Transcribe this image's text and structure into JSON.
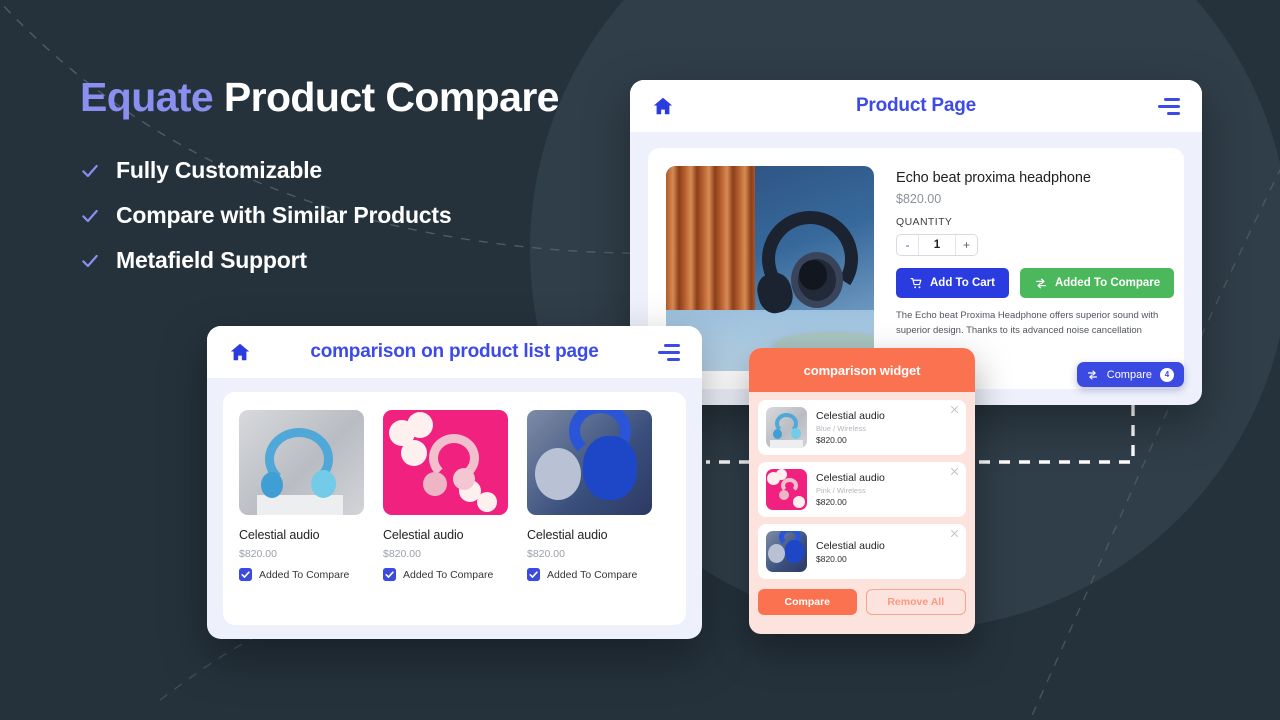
{
  "hero": {
    "title_accent": "Equate",
    "title_rest": " Product Compare",
    "features": [
      {
        "label": "Fully Customizable",
        "icon": "check-icon"
      },
      {
        "label": "Compare with Similar Products",
        "icon": "check-icon"
      },
      {
        "label": "Metafield Support",
        "icon": "check-icon"
      }
    ]
  },
  "product_page": {
    "topbar": {
      "title": "Product Page",
      "home_icon": "home-icon",
      "menu_icon": "hamburger-icon"
    },
    "product": {
      "title": "Echo beat proxima headphone",
      "price": "$820.00",
      "quantity_label": "QUANTITY",
      "quantity_value": "1",
      "decrement": "-",
      "increment": "+",
      "add_to_cart_label": "Add To Cart",
      "added_to_compare_label": "Added To Compare",
      "description": "The Echo beat Proxima Headphone offers superior sound with superior design. Thanks to its advanced noise cancellation"
    },
    "floating_compare": {
      "label": "Compare",
      "count": "4"
    }
  },
  "product_list": {
    "topbar": {
      "title": "comparison on product list page",
      "home_icon": "home-icon",
      "menu_icon": "hamburger-icon"
    },
    "items": [
      {
        "name": "Celestial audio",
        "price": "$820.00",
        "check_label": "Added To Compare",
        "checked": true,
        "thumb": "blue-headphones-grey-bg"
      },
      {
        "name": "Celestial audio",
        "price": "$820.00",
        "check_label": "Added To Compare",
        "checked": true,
        "thumb": "pink-headphones-pink-bg"
      },
      {
        "name": "Celestial audio",
        "price": "$820.00",
        "check_label": "Added To Compare",
        "checked": true,
        "thumb": "blue-silver-headphones"
      }
    ]
  },
  "comparison_widget": {
    "title": "comparison widget",
    "items": [
      {
        "name": "Celestial audio",
        "variant": "Blue / Wireless",
        "price": "$820.00",
        "close_icon": "close-icon"
      },
      {
        "name": "Celestial audio",
        "variant": "Pink / Wireless",
        "price": "$820.00",
        "close_icon": "close-icon"
      },
      {
        "name": "Celestial audio",
        "variant": "",
        "price": "$820.00",
        "close_icon": "close-icon"
      }
    ],
    "compare_label": "Compare",
    "remove_all_label": "Remove All"
  },
  "colors": {
    "background": "#25323c",
    "accent_purple": "#8b8ff0",
    "brand_blue": "#3c4ae8",
    "coral": "#fa7250",
    "green": "#4cb85c"
  }
}
